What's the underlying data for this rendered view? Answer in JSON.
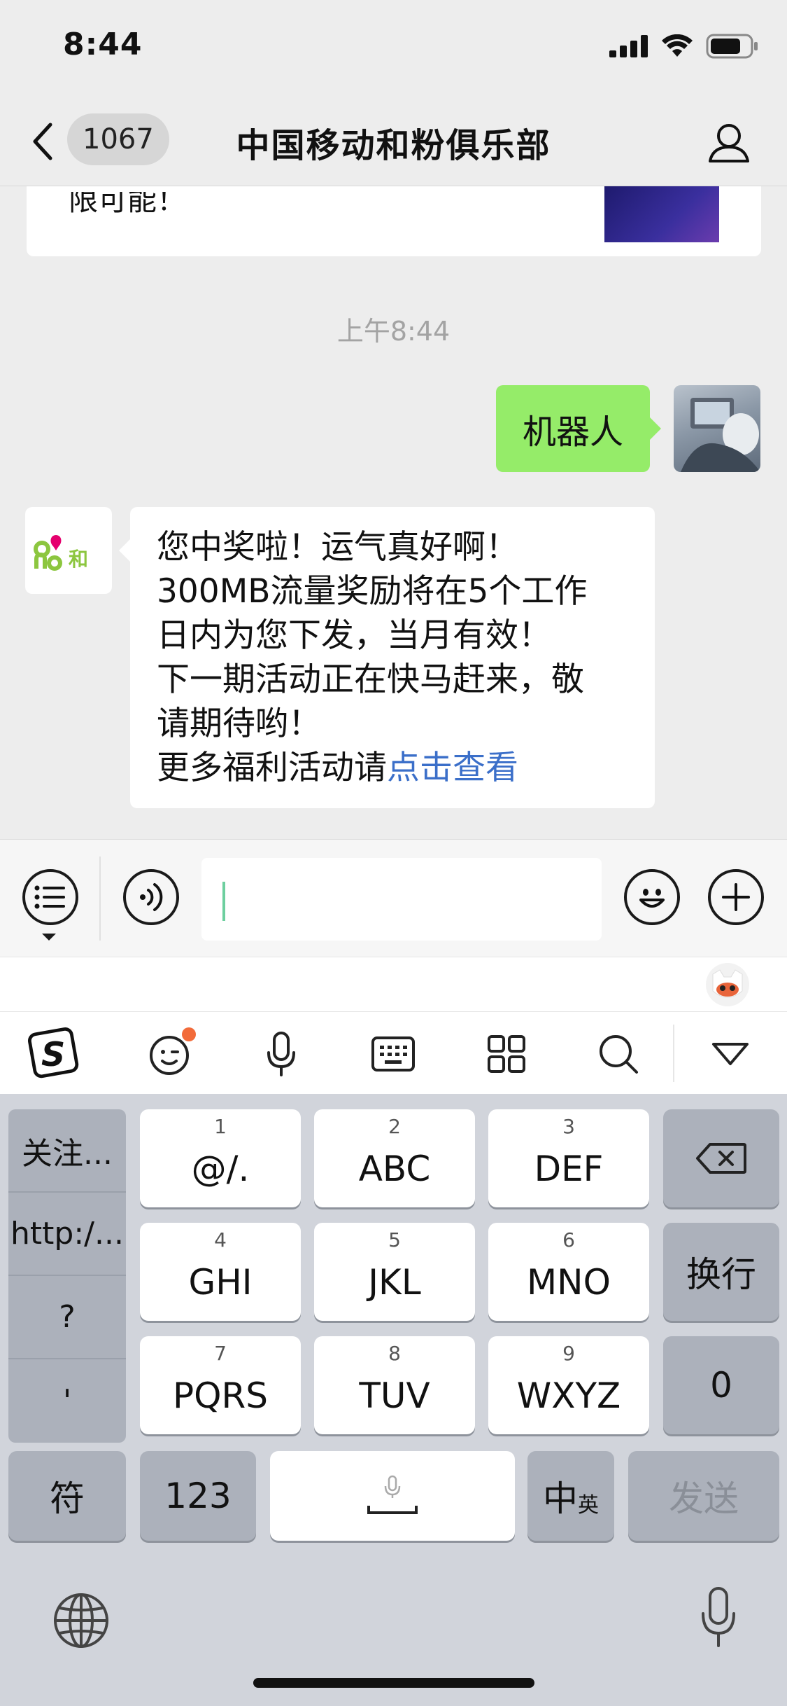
{
  "status_bar": {
    "time": "8:44"
  },
  "nav": {
    "unread_count": "1067",
    "title": "中国移动和粉俱乐部"
  },
  "chat": {
    "prev_card_text": "限可能！",
    "timestamp": "上午8:44",
    "my_message": "机器人",
    "bot_lines": [
      "您中奖啦！运气真好啊！",
      "300MB流量奖励将在5个工作",
      "日内为您下发，当月有效！",
      "下一期活动正在快马赶来，敬",
      "请期待哟！"
    ],
    "bot_last_prefix": "更多福利活动请",
    "bot_link": "点击查看"
  },
  "keyboard": {
    "side_items": [
      "关注...",
      "http:/...",
      "?",
      "'"
    ],
    "keys": [
      {
        "num": "1",
        "label": "@/."
      },
      {
        "num": "2",
        "label": "ABC"
      },
      {
        "num": "3",
        "label": "DEF"
      },
      {
        "num": "4",
        "label": "GHI"
      },
      {
        "num": "5",
        "label": "JKL"
      },
      {
        "num": "6",
        "label": "MNO"
      },
      {
        "num": "7",
        "label": "PQRS"
      },
      {
        "num": "8",
        "label": "TUV"
      },
      {
        "num": "9",
        "label": "WXYZ"
      }
    ],
    "newline": "换行",
    "zero": "0",
    "symbols": "符",
    "numbers": "123",
    "chinese": "中",
    "english_sub": "英",
    "send": "发送"
  }
}
